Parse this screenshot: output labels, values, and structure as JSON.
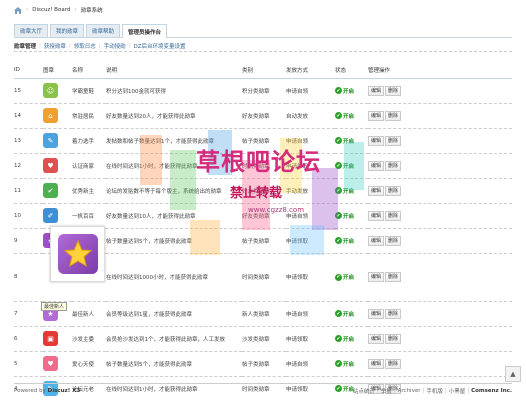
{
  "breadcrumb": {
    "items": [
      "Discuz! Board",
      "勋章系统"
    ]
  },
  "tabs": [
    "勋章大厅",
    "我的勋章",
    "勋章帮助",
    "管理员操作台"
  ],
  "subnav": [
    "勋章管理",
    "获授勋章",
    "领取日志",
    "手动授勋",
    "DZ后台环境变量设置"
  ],
  "table": {
    "headers": [
      "ID",
      "图章",
      "名称",
      "说明",
      "类别",
      "发放方式",
      "状态",
      "管理操作"
    ],
    "status_label": "开启",
    "edit_label": "编辑",
    "delete_label": "删除",
    "rows": [
      {
        "id": "15",
        "icon_color": "#8bc34a",
        "icon": "☺",
        "name": "学霸童鞋",
        "desc": "积分达到100金就可获得",
        "type": "积分类勋章",
        "method": "申请自领"
      },
      {
        "id": "14",
        "icon_color": "#f0a030",
        "icon": "⌂",
        "name": "常驻居民",
        "desc": "好友数量达到20人，才能获得此勋章",
        "type": "好友类勋章",
        "method": "自动发放"
      },
      {
        "id": "13",
        "icon_color": "#4aa3df",
        "icon": "✎",
        "name": "着力选手",
        "desc": "发帖数和帖子数量达到1个，才能获得此勋章",
        "type": "帖子类勋章",
        "method": "申请自领"
      },
      {
        "id": "12",
        "icon_color": "#e05050",
        "icon": "♥",
        "name": "认证商家",
        "desc": "在线时间达到1小时，才能获得此勋章",
        "type": "时间类勋章",
        "method": "申请领取"
      },
      {
        "id": "11",
        "icon_color": "#4caf50",
        "icon": "✔",
        "name": "优秀新主",
        "desc": "论坛的发贴数不等于每个版主，系统给出的勋章",
        "type": "好友类勋章",
        "method": "手动发放"
      },
      {
        "id": "10",
        "icon_color": "#3d8fd6",
        "icon": "✐",
        "name": "一帆百百",
        "desc": "好友数量达到10人，才能获得此勋章",
        "type": "好友类勋章",
        "method": "申请自领"
      },
      {
        "id": "9",
        "icon_color": "#9c4dcc",
        "icon": "★",
        "name": "",
        "desc": "帖子数量达到5个，才能获得此勋章",
        "type": "帖子类勋章",
        "method": "申请领取"
      },
      {
        "id": "8",
        "icon_color": "",
        "icon": "",
        "name": "",
        "desc": "在线时间达到1000小时，才能获得此勋章",
        "type": "时间类勋章",
        "method": "申请领取"
      },
      {
        "id": "7",
        "icon_color": "#b26ad6",
        "icon": "★",
        "name": "最佳新人",
        "desc": "会员等级达到1星，才能获得此勋章",
        "type": "新人类勋章",
        "method": "申请自领"
      },
      {
        "id": "6",
        "icon_color": "#e53935",
        "icon": "▣",
        "name": "沙发主委",
        "desc": "会员抢沙发达到1个，才能获得此勋章，人工发放",
        "type": "沙发类勋章",
        "method": "申请领取"
      },
      {
        "id": "5",
        "icon_color": "#ef6c8c",
        "icon": "♥",
        "name": "爱心天使",
        "desc": "帖子数量达到5个，才能获得此勋章",
        "type": "帖子类勋章",
        "method": "申请自领"
      },
      {
        "id": "4",
        "icon_color": "#4fb3e8",
        "icon": "✎",
        "name": "论坛元老",
        "desc": "在线时间达到1小时，才能获得此勋章",
        "type": "时间类勋章",
        "method": "申请领取"
      }
    ]
  },
  "tooltip": "最佳新人",
  "watermark": {
    "title": "草根吧论坛",
    "subtitle": "禁止转载",
    "url": "www.cgzz8.com"
  },
  "footer": {
    "powered_prefix": "Powered by",
    "brand": "Discuz! X3",
    "links": [
      "站点统计",
      "举报",
      "Archiver",
      "手机版",
      "小黑屋"
    ],
    "company": "Comsenz Inc."
  }
}
